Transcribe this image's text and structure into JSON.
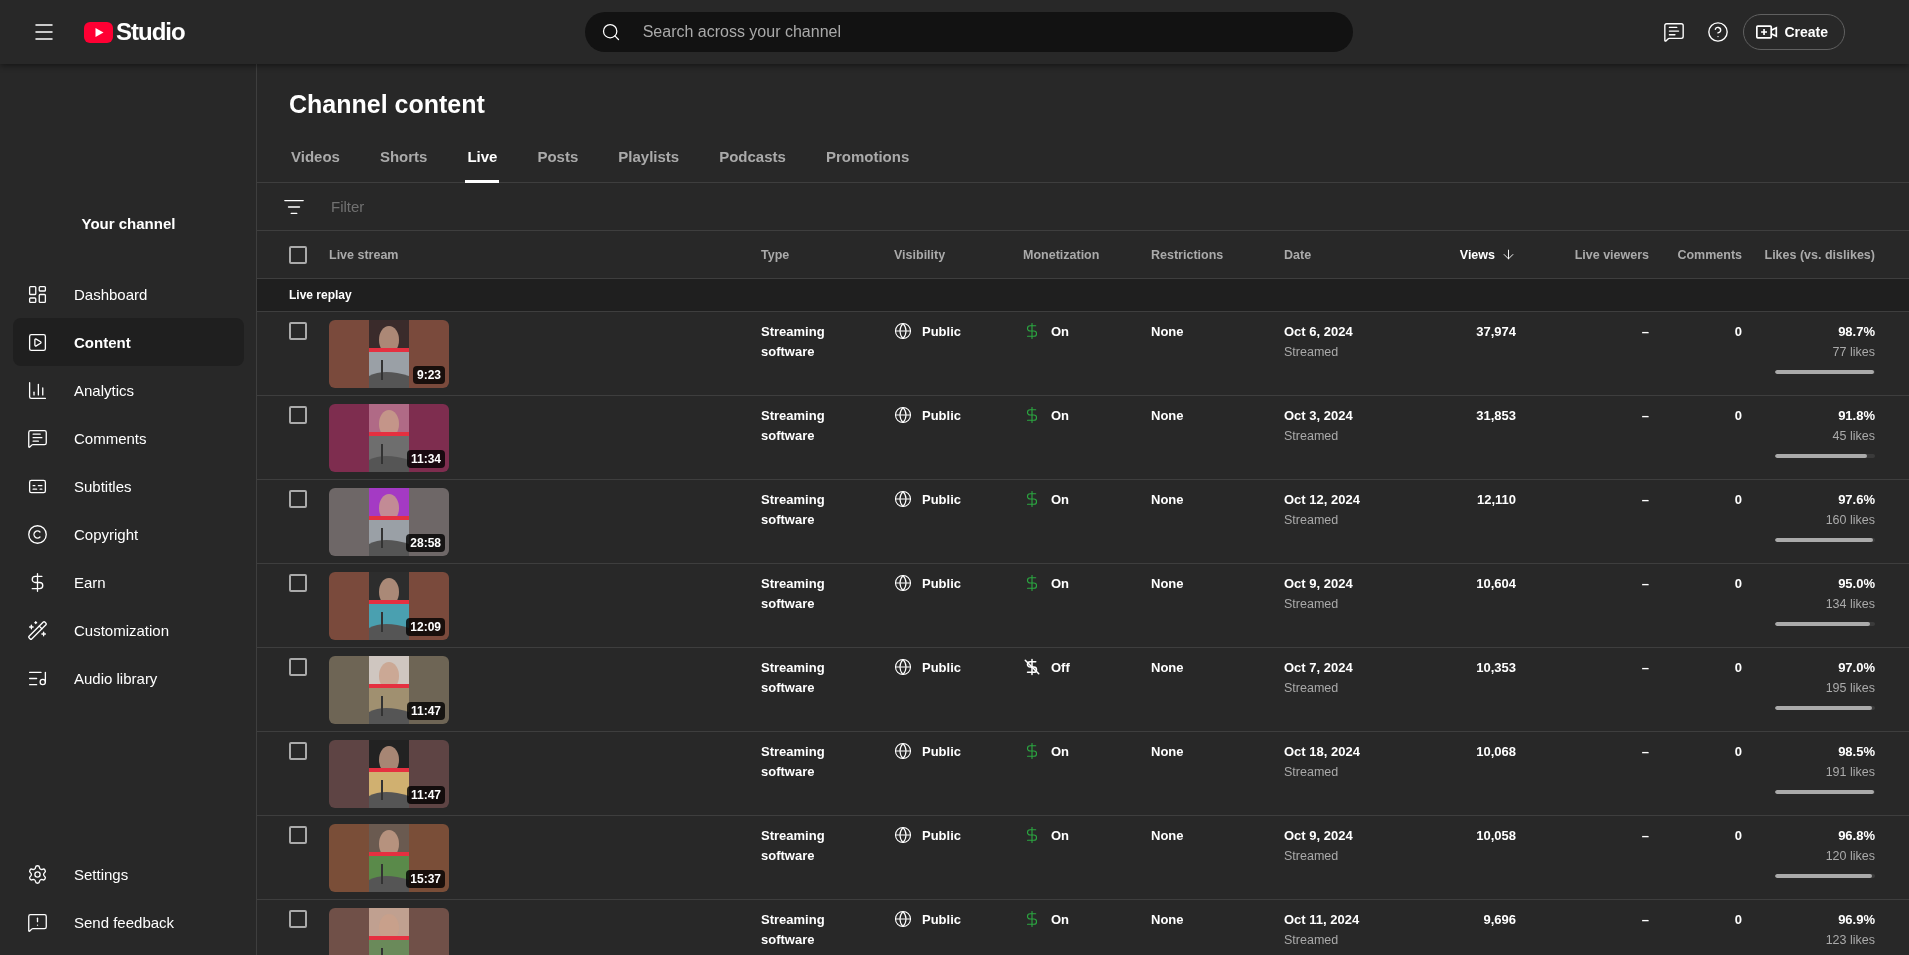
{
  "app": {
    "logo_text": "Studio"
  },
  "search": {
    "placeholder": "Search across your channel"
  },
  "create_button": "Create",
  "sidebar": {
    "channel_label": "Your channel",
    "items": [
      {
        "label": "Dashboard",
        "selected": false
      },
      {
        "label": "Content",
        "selected": true
      },
      {
        "label": "Analytics",
        "selected": false
      },
      {
        "label": "Comments",
        "selected": false
      },
      {
        "label": "Subtitles",
        "selected": false
      },
      {
        "label": "Copyright",
        "selected": false
      },
      {
        "label": "Earn",
        "selected": false
      },
      {
        "label": "Customization",
        "selected": false
      },
      {
        "label": "Audio library",
        "selected": false
      }
    ],
    "footer_items": [
      {
        "label": "Settings",
        "selected": false
      },
      {
        "label": "Send feedback",
        "selected": false
      }
    ]
  },
  "page": {
    "title": "Channel content"
  },
  "tabs": [
    {
      "label": "Videos",
      "selected": false
    },
    {
      "label": "Shorts",
      "selected": false
    },
    {
      "label": "Live",
      "selected": true
    },
    {
      "label": "Posts",
      "selected": false
    },
    {
      "label": "Playlists",
      "selected": false
    },
    {
      "label": "Podcasts",
      "selected": false
    },
    {
      "label": "Promotions",
      "selected": false
    }
  ],
  "filter": {
    "placeholder": "Filter"
  },
  "table": {
    "select_all": {
      "checked": false
    },
    "columns": [
      {
        "label": "Live stream",
        "sorted": false
      },
      {
        "label": "Type",
        "sorted": false
      },
      {
        "label": "Visibility",
        "sorted": false
      },
      {
        "label": "Monetization",
        "sorted": false
      },
      {
        "label": "Restrictions",
        "sorted": false
      },
      {
        "label": "Date",
        "sorted": false
      },
      {
        "label": "Views",
        "sorted": true
      },
      {
        "label": "Live viewers",
        "sorted": false
      },
      {
        "label": "Comments",
        "sorted": false
      },
      {
        "label": "Likes (vs. dislikes)",
        "sorted": false
      }
    ],
    "section_label": "Live replay",
    "rows": [
      {
        "checked": false,
        "duration": "9:23",
        "type": "Streaming software",
        "visibility": "Public",
        "monetization": {
          "on": true,
          "label": "On"
        },
        "restrictions": "None",
        "date": "Oct 6, 2024",
        "date_note": "Streamed",
        "views": "37,974",
        "live_viewers": "–",
        "comments": "0",
        "likes_percent": "98.7%",
        "likes_count": "77 likes",
        "level": 0.987
      },
      {
        "checked": false,
        "duration": "11:34",
        "type": "Streaming software",
        "visibility": "Public",
        "monetization": {
          "on": true,
          "label": "On"
        },
        "restrictions": "None",
        "date": "Oct 3, 2024",
        "date_note": "Streamed",
        "views": "31,853",
        "live_viewers": "–",
        "comments": "0",
        "likes_percent": "91.8%",
        "likes_count": "45 likes",
        "level": 0.918
      },
      {
        "checked": false,
        "duration": "28:58",
        "type": "Streaming software",
        "visibility": "Public",
        "monetization": {
          "on": true,
          "label": "On"
        },
        "restrictions": "None",
        "date": "Oct 12, 2024",
        "date_note": "Streamed",
        "views": "12,110",
        "live_viewers": "–",
        "comments": "0",
        "likes_percent": "97.6%",
        "likes_count": "160 likes",
        "level": 0.976
      },
      {
        "checked": false,
        "duration": "12:09",
        "type": "Streaming software",
        "visibility": "Public",
        "monetization": {
          "on": true,
          "label": "On"
        },
        "restrictions": "None",
        "date": "Oct 9, 2024",
        "date_note": "Streamed",
        "views": "10,604",
        "live_viewers": "–",
        "comments": "0",
        "likes_percent": "95.0%",
        "likes_count": "134 likes",
        "level": 0.95
      },
      {
        "checked": false,
        "duration": "11:47",
        "type": "Streaming software",
        "visibility": "Public",
        "monetization": {
          "on": false,
          "label": "Off"
        },
        "restrictions": "None",
        "date": "Oct 7, 2024",
        "date_note": "Streamed",
        "views": "10,353",
        "live_viewers": "–",
        "comments": "0",
        "likes_percent": "97.0%",
        "likes_count": "195 likes",
        "level": 0.97
      },
      {
        "checked": false,
        "duration": "11:47",
        "type": "Streaming software",
        "visibility": "Public",
        "monetization": {
          "on": true,
          "label": "On"
        },
        "restrictions": "None",
        "date": "Oct 18, 2024",
        "date_note": "Streamed",
        "views": "10,068",
        "live_viewers": "–",
        "comments": "0",
        "likes_percent": "98.5%",
        "likes_count": "191 likes",
        "level": 0.985
      },
      {
        "checked": false,
        "duration": "15:37",
        "type": "Streaming software",
        "visibility": "Public",
        "monetization": {
          "on": true,
          "label": "On"
        },
        "restrictions": "None",
        "date": "Oct 9, 2024",
        "date_note": "Streamed",
        "views": "10,058",
        "live_viewers": "–",
        "comments": "0",
        "likes_percent": "96.8%",
        "likes_count": "120 likes",
        "level": 0.968
      },
      {
        "checked": false,
        "type": "Streaming software",
        "visibility": "Public",
        "monetization": {
          "on": true,
          "label": "On"
        },
        "restrictions": "None",
        "date": "Oct 11, 2024",
        "date_note": "Streamed",
        "views": "9,696",
        "live_viewers": "–",
        "comments": "0",
        "likes_percent": "96.9%",
        "likes_count": "123 likes"
      }
    ]
  }
}
